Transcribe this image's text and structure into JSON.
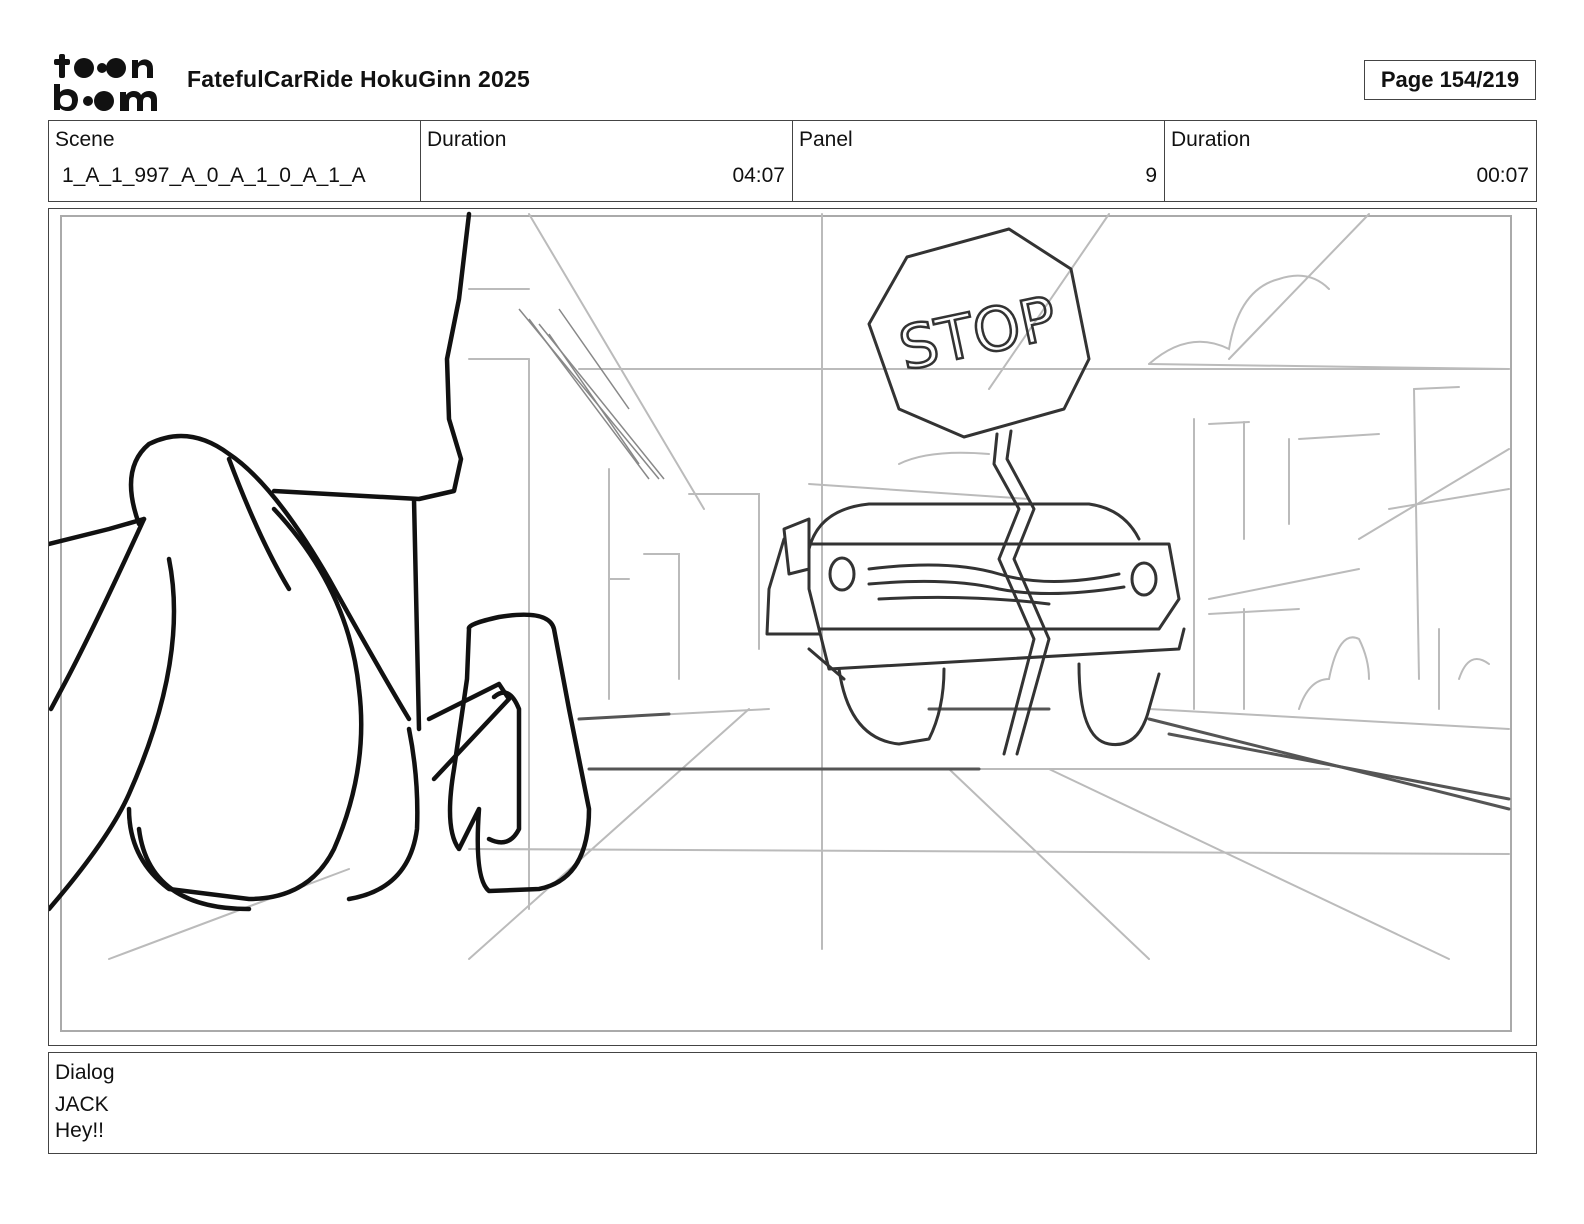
{
  "header": {
    "logo_text": "toon boom",
    "project_title": "FatefulCarRide HokuGinn 2025",
    "page_indicator": "Page 154/219"
  },
  "meta": {
    "scene_label": "Scene",
    "scene_value": "1_A_1_997_A_0_A_1_0_A_1_A",
    "scene_duration_label": "Duration",
    "scene_duration_value": "04:07",
    "panel_label": "Panel",
    "panel_value": "9",
    "panel_duration_label": "Duration",
    "panel_duration_value": "00:07"
  },
  "panel_image": {
    "sign_text": "STOP"
  },
  "dialog": {
    "label": "Dialog",
    "speaker": "JACK",
    "line": "Hey!!"
  },
  "colors": {
    "border": "#444444",
    "sketch_dark": "#111111",
    "sketch_mid": "#333333",
    "sketch_light": "#b8b8b8"
  }
}
